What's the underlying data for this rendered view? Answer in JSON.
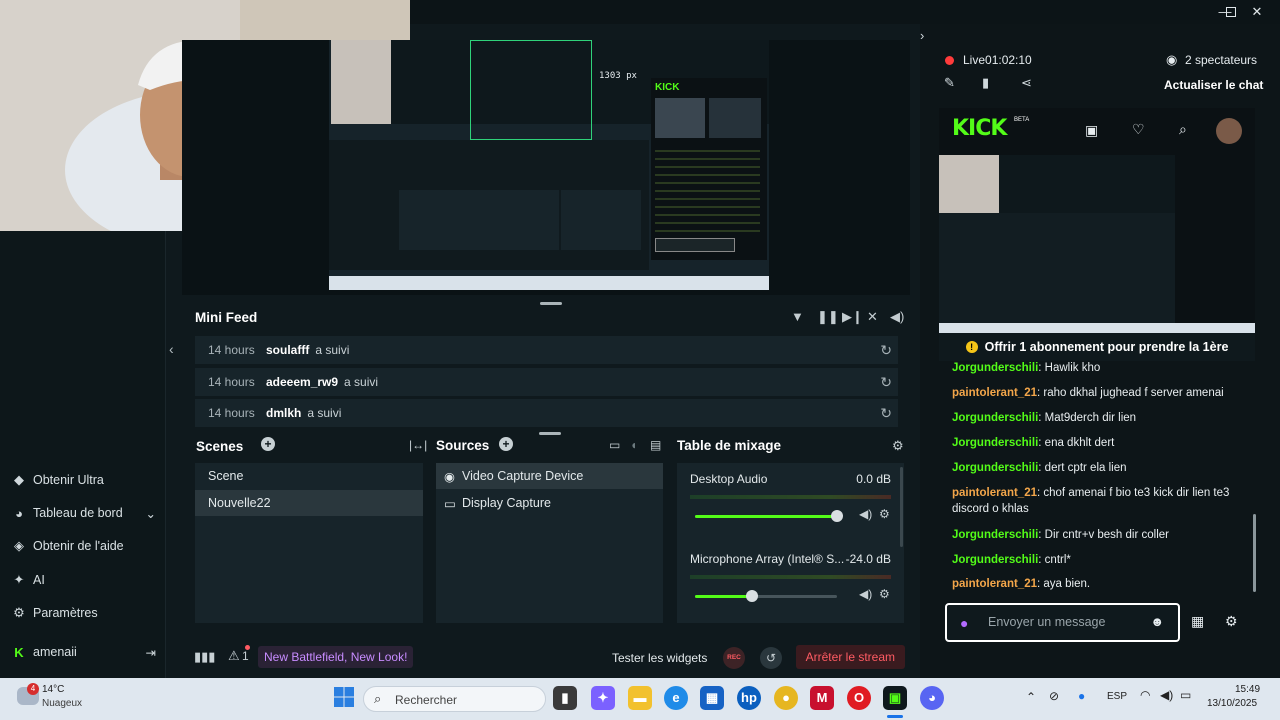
{
  "live": {
    "time": "Live01:02:10",
    "viewers": "2 spectateurs",
    "refresh_chat": "Actualiser le chat"
  },
  "minifeed": {
    "title": "Mini Feed",
    "rows": [
      {
        "time": "14 hours",
        "user": "soulafff",
        "action": "a suivi"
      },
      {
        "time": "14 hours",
        "user": "adeeem_rw9",
        "action": "a suivi"
      },
      {
        "time": "14 hours",
        "user": "dmlkh",
        "action": "a suivi"
      }
    ]
  },
  "scenes": {
    "title": "Scenes",
    "items": [
      "Scene",
      "Nouvelle22"
    ]
  },
  "sources": {
    "title": "Sources",
    "items": [
      "Video Capture Device",
      "Display Capture"
    ]
  },
  "mixer": {
    "title": "Table de mixage",
    "channels": [
      {
        "name": "Desktop Audio",
        "db": "0.0 dB",
        "level": 1.0
      },
      {
        "name": "Microphone Array (Intel® S...",
        "db": "-24.0 dB",
        "level": 0.4
      }
    ]
  },
  "sidebar": {
    "items": [
      "Obtenir Ultra",
      "Tableau de bord",
      "Obtenir de l'aide",
      "AI",
      "Paramètres"
    ],
    "account": "amenaii"
  },
  "bottombar": {
    "alerts_count": "1",
    "promo": "New Battlefield, New Look!",
    "test_widgets": "Tester les widgets",
    "rec_label": "REC",
    "stop_stream": "Arrêter le stream"
  },
  "chat": {
    "kick_logo": "KICK",
    "kick_beta": "BETA",
    "gift_banner": "Offrir 1 abonnement pour prendre la 1ère",
    "messages": [
      {
        "user": "Jorgunderschili",
        "color": "green",
        "text": "Hawlik kho"
      },
      {
        "user": "paintolerant_21",
        "color": "orange",
        "text": "raho dkhal jughead f server amenai"
      },
      {
        "user": "Jorgunderschili",
        "color": "green",
        "text": "Mat9derch dir lien"
      },
      {
        "user": "Jorgunderschili",
        "color": "green",
        "text": "ena dkhlt dert"
      },
      {
        "user": "Jorgunderschili",
        "color": "green",
        "text": "dert cptr ela lien"
      },
      {
        "user": "paintolerant_21",
        "color": "orange",
        "text": "chof amenai f bio te3 kick dir lien te3 discord o khlas"
      },
      {
        "user": "Jorgunderschili",
        "color": "green",
        "text": "Dir cntr+v besh dir coller"
      },
      {
        "user": "Jorgunderschili",
        "color": "green",
        "text": "cntrl*"
      },
      {
        "user": "paintolerant_21",
        "color": "orange",
        "text": "aya bien."
      }
    ],
    "input_placeholder": "Envoyer un message"
  },
  "taskbar": {
    "weather_temp": "14°C",
    "weather_desc": "Nuageux",
    "weather_badge": "4",
    "search_placeholder": "Rechercher",
    "lang": "ESP",
    "time": "15:49",
    "date": "13/10/2025"
  },
  "preview": {
    "measure": "1303 px"
  },
  "colors": {
    "kick_green": "#53fc18",
    "stop_red": "#ff5b63",
    "promo_purple": "#c88cff",
    "user_orange": "#f3a64a"
  }
}
